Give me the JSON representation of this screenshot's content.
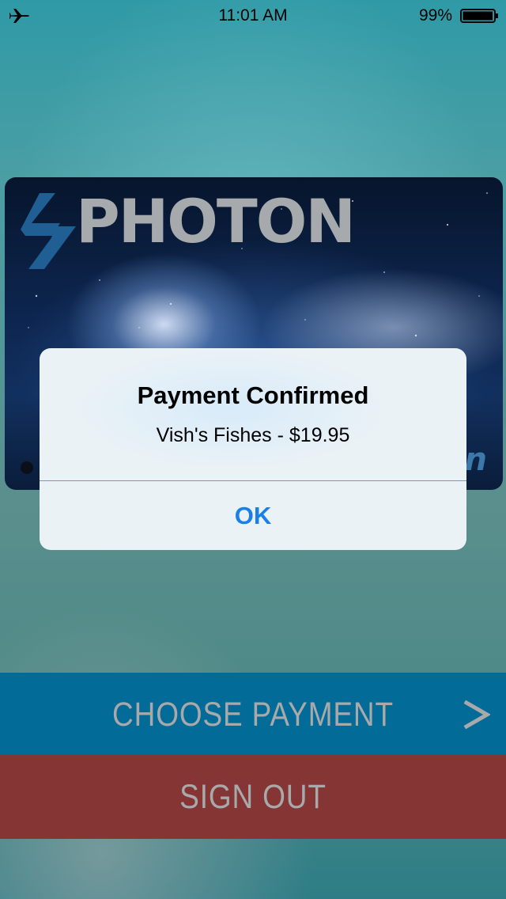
{
  "status_bar": {
    "time": "11:01 AM",
    "battery_percent": "99%",
    "battery_level": 0.99,
    "icons": [
      "airplane-icon",
      "battery-icon"
    ]
  },
  "card": {
    "brand_name": "PHOTON",
    "brand_fragment": "n",
    "logo_color": "#1f5f93",
    "text_color": "#a7aaad"
  },
  "alert": {
    "title": "Payment Confirmed",
    "message": "Vish's Fishes - $19.95",
    "ok_label": "OK",
    "button_color": "#1a7fe6"
  },
  "actions": {
    "choose_payment_label": "CHOOSE PAYMENT",
    "choose_payment_icon": "chevron-right-icon",
    "choose_payment_color": "#036b97",
    "sign_out_label": "SIGN OUT",
    "sign_out_color": "#843534"
  }
}
